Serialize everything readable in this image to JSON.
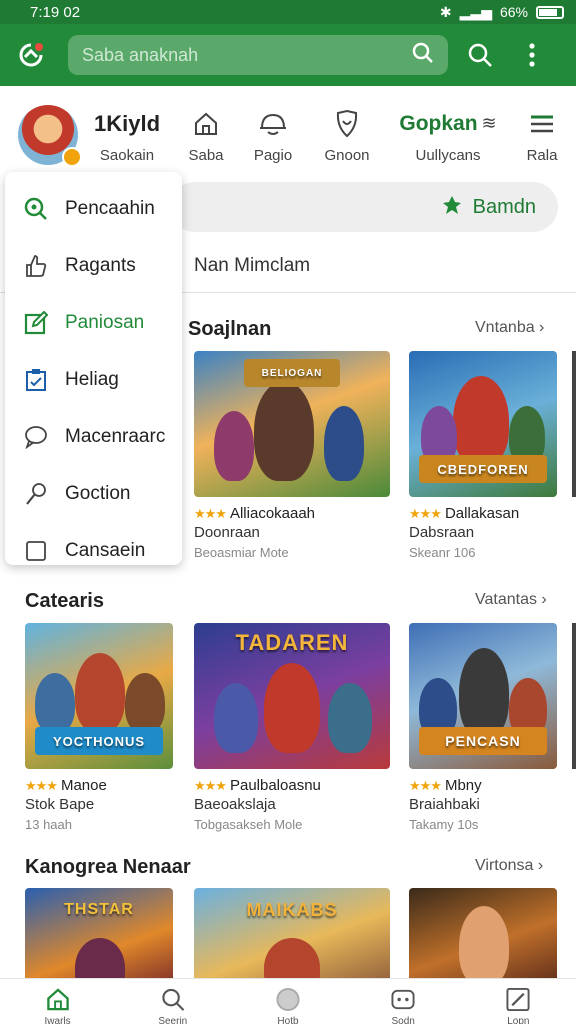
{
  "status_bar": {
    "time": "7:19 02",
    "battery": "66%"
  },
  "app_bar": {
    "search_placeholder": "Saba anaknah"
  },
  "nav_header": {
    "items": [
      {
        "title": "1Kiyld",
        "label": "Saokain"
      },
      {
        "label": "Saba"
      },
      {
        "label": "Pagio"
      },
      {
        "label": "Gnoon"
      },
      {
        "title": "Gopkan",
        "label": "Uullycans"
      },
      {
        "label": "Rala"
      }
    ]
  },
  "filter": {
    "label": "Bamdn",
    "subtitle": "Nan Mimclam"
  },
  "menu": {
    "items": [
      {
        "label": "Pencaahin",
        "icon": "search-icon"
      },
      {
        "label": "Ragants",
        "icon": "thumbs-up-icon"
      },
      {
        "label": "Paniosan",
        "icon": "edit-icon",
        "active": true
      },
      {
        "label": "Heliag",
        "icon": "clipboard-check-icon"
      },
      {
        "label": "Macenraarc",
        "icon": "chat-bubble-icon"
      },
      {
        "label": "Goction",
        "icon": "pin-icon"
      },
      {
        "label": "Cansaein",
        "icon": "checkbox-icon"
      }
    ]
  },
  "sections": [
    {
      "title": "Soajlnan",
      "more": "Vntanba",
      "cards": [
        {
          "banner": "BELIOGAN",
          "name": "Alliacokaaah",
          "line2": "Doonraan",
          "line3": "Beoasmiar Mote",
          "stars": "★★★"
        },
        {
          "banner": "CBEDFOREN",
          "name": "Dallakasan",
          "line2": "Dabsraan",
          "line3": "Skeanr 106",
          "stars": "★★★"
        }
      ]
    },
    {
      "title": "Catearis",
      "more": "Vatantas",
      "cards": [
        {
          "banner": "YOCTHONUS",
          "name": "Manoe",
          "line2": "Stok Bape",
          "line3": "13 haah",
          "stars": "★★★"
        },
        {
          "banner": "TADAREN",
          "name": "Paulbaloasnu",
          "line2": "Baeoakslaja",
          "line3": "Tobgasakseh Mole",
          "stars": "★★★"
        },
        {
          "banner": "PENCASN",
          "name": "Mbny",
          "line2": "Braiahbaki",
          "line3": "Takamy 10s",
          "stars": "★★★"
        }
      ]
    },
    {
      "title": "Kanogrea Nenaar",
      "more": "Virtonsa",
      "cards": [
        {
          "banner": "THSTAR"
        },
        {
          "banner": "MAIKABS"
        },
        {
          "banner": ""
        }
      ]
    }
  ],
  "bottom_nav": {
    "items": [
      {
        "label": "Iwarls",
        "icon": "home-icon"
      },
      {
        "label": "Seerin",
        "icon": "search-icon"
      },
      {
        "label": "Hotb",
        "icon": "circle-icon"
      },
      {
        "label": "Sodn",
        "icon": "game-controller-icon"
      },
      {
        "label": "Lopn",
        "icon": "edit-icon"
      }
    ]
  },
  "colors": {
    "brand_green": "#228b3a",
    "dark_green": "#1f7a34",
    "star": "#f0a30a"
  }
}
